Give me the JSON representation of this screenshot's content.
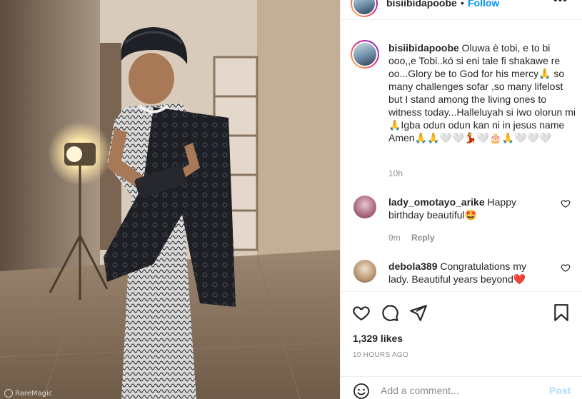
{
  "post": {
    "username": "bisiibidapoobe",
    "dot": "•",
    "follow_label": "Follow",
    "more_icon": "more-horizontal-icon"
  },
  "caption": {
    "username": "bisiibidapoobe",
    "text": "Oluwa è tobi, e to bi ooo,,e Tobi..kó si eni tale fi shakawe re oo...Glory be to God for his mercy🙏 so many challenges sofar ,so many lifelost but I stand among the living ones to witness today...Halleluyah si íwo olorun mi🙏Igba odun odun kan ni in jesus name Amen🙏🙏🤍🤍💃🤍🎂🙏🤍🤍🤍",
    "time": "10h"
  },
  "comments": [
    {
      "username": "lady_omotayo_arike",
      "text": "Happy birthday beautiful🤩",
      "time": "9m",
      "reply_label": "Reply"
    },
    {
      "username": "debola389",
      "text": "Congratulations my lady. Beautiful years beyond❤️"
    }
  ],
  "actions": {
    "like_icon": "heart-icon",
    "comment_icon": "comment-icon",
    "share_icon": "share-icon",
    "save_icon": "bookmark-icon"
  },
  "likes": "1,329 likes",
  "posted": "10 HOURS AGO",
  "add_comment": {
    "placeholder": "Add a comment...",
    "post_label": "Post"
  },
  "watermark": "RareMagic",
  "colors": {
    "accent": "#0095f6",
    "post_disabled": "#b2dffc",
    "secondary_text": "#8e8e8e",
    "like_red": "#ed4956"
  }
}
